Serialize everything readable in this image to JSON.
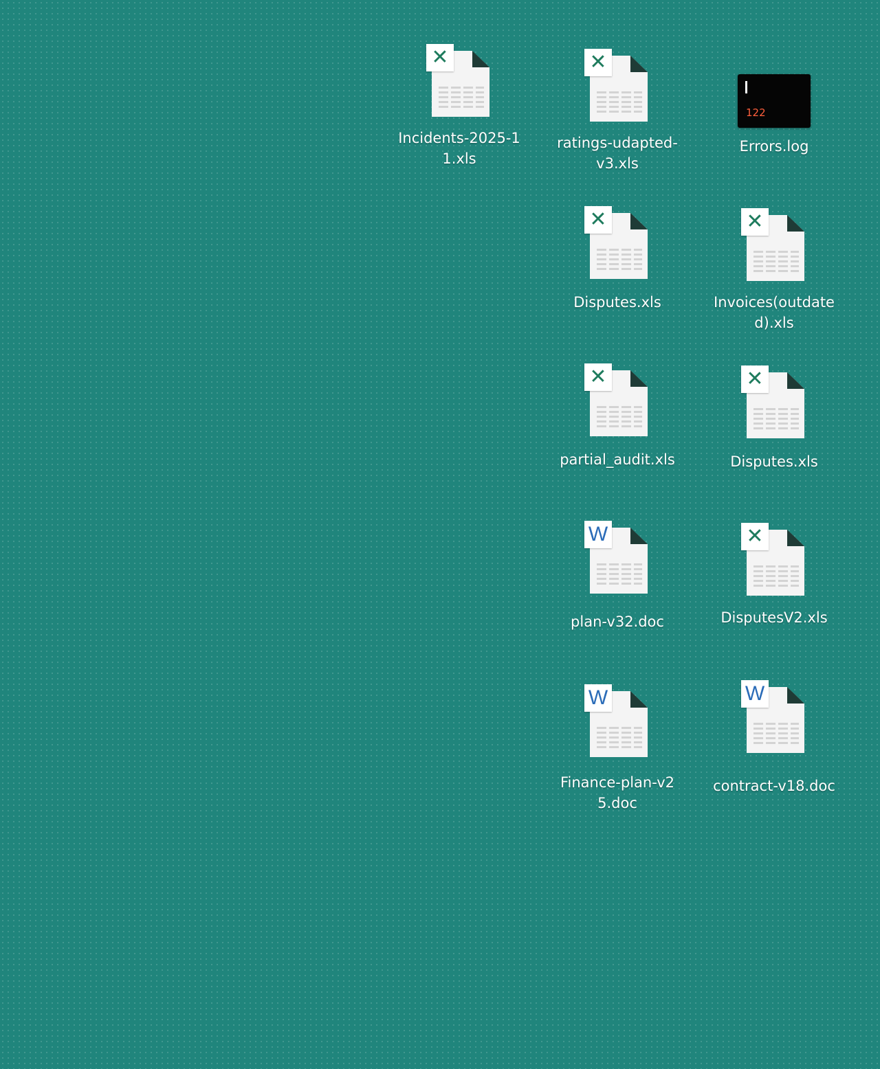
{
  "desktop": {
    "background_color": "#20857c",
    "icons": [
      {
        "label": "Incidents-2025-11.xls",
        "type": "xls",
        "badge": "✕",
        "icon": "excel-file-icon"
      },
      {
        "label": "ratings-udapted-v3.xls",
        "type": "xls",
        "badge": "✕",
        "icon": "excel-file-icon"
      },
      {
        "label": "Errors.log",
        "type": "log",
        "terminal_text": "122",
        "icon": "terminal-log-icon"
      },
      {
        "label": "Disputes.xls",
        "type": "xls",
        "badge": "✕",
        "icon": "excel-file-icon"
      },
      {
        "label": "Invoices(outdated).xls",
        "type": "xls",
        "badge": "✕",
        "icon": "excel-file-icon"
      },
      {
        "label": "partial_audit.xls",
        "type": "xls",
        "badge": "✕",
        "icon": "excel-file-icon"
      },
      {
        "label": "Disputes.xls",
        "type": "xls",
        "badge": "✕",
        "icon": "excel-file-icon"
      },
      {
        "label": "plan-v32.doc",
        "type": "doc",
        "badge": "W",
        "icon": "word-file-icon"
      },
      {
        "label": "DisputesV2.xls",
        "type": "xls",
        "badge": "✕",
        "icon": "excel-file-icon"
      },
      {
        "label": "Finance-plan-v25.doc",
        "type": "doc",
        "badge": "W",
        "icon": "word-file-icon"
      },
      {
        "label": "contract-v18.doc",
        "type": "doc",
        "badge": "W",
        "icon": "word-file-icon"
      }
    ]
  }
}
